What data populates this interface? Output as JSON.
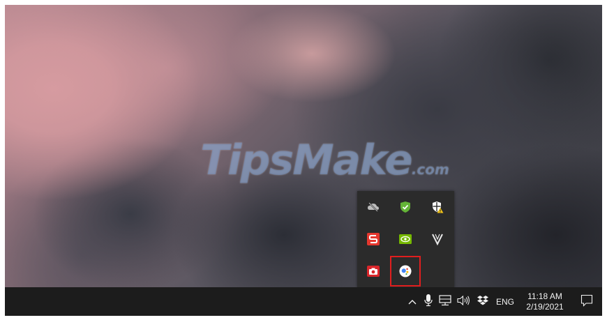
{
  "watermark": {
    "text": "TipsMake",
    "suffix": ".com"
  },
  "overflow_tray": {
    "icons": [
      {
        "name": "cloud-offline-icon"
      },
      {
        "name": "shield-check-icon"
      },
      {
        "name": "windows-security-warning-icon"
      },
      {
        "name": "wps-office-icon"
      },
      {
        "name": "nvidia-icon"
      },
      {
        "name": "vectorstyler-icon"
      },
      {
        "name": "camera-icon"
      },
      {
        "name": "google-assistant-icon",
        "highlighted": true
      }
    ],
    "highlight_color": "#e11e1e"
  },
  "taskbar": {
    "language": "ENG",
    "time": "11:18 AM",
    "date": "2/19/2021"
  }
}
